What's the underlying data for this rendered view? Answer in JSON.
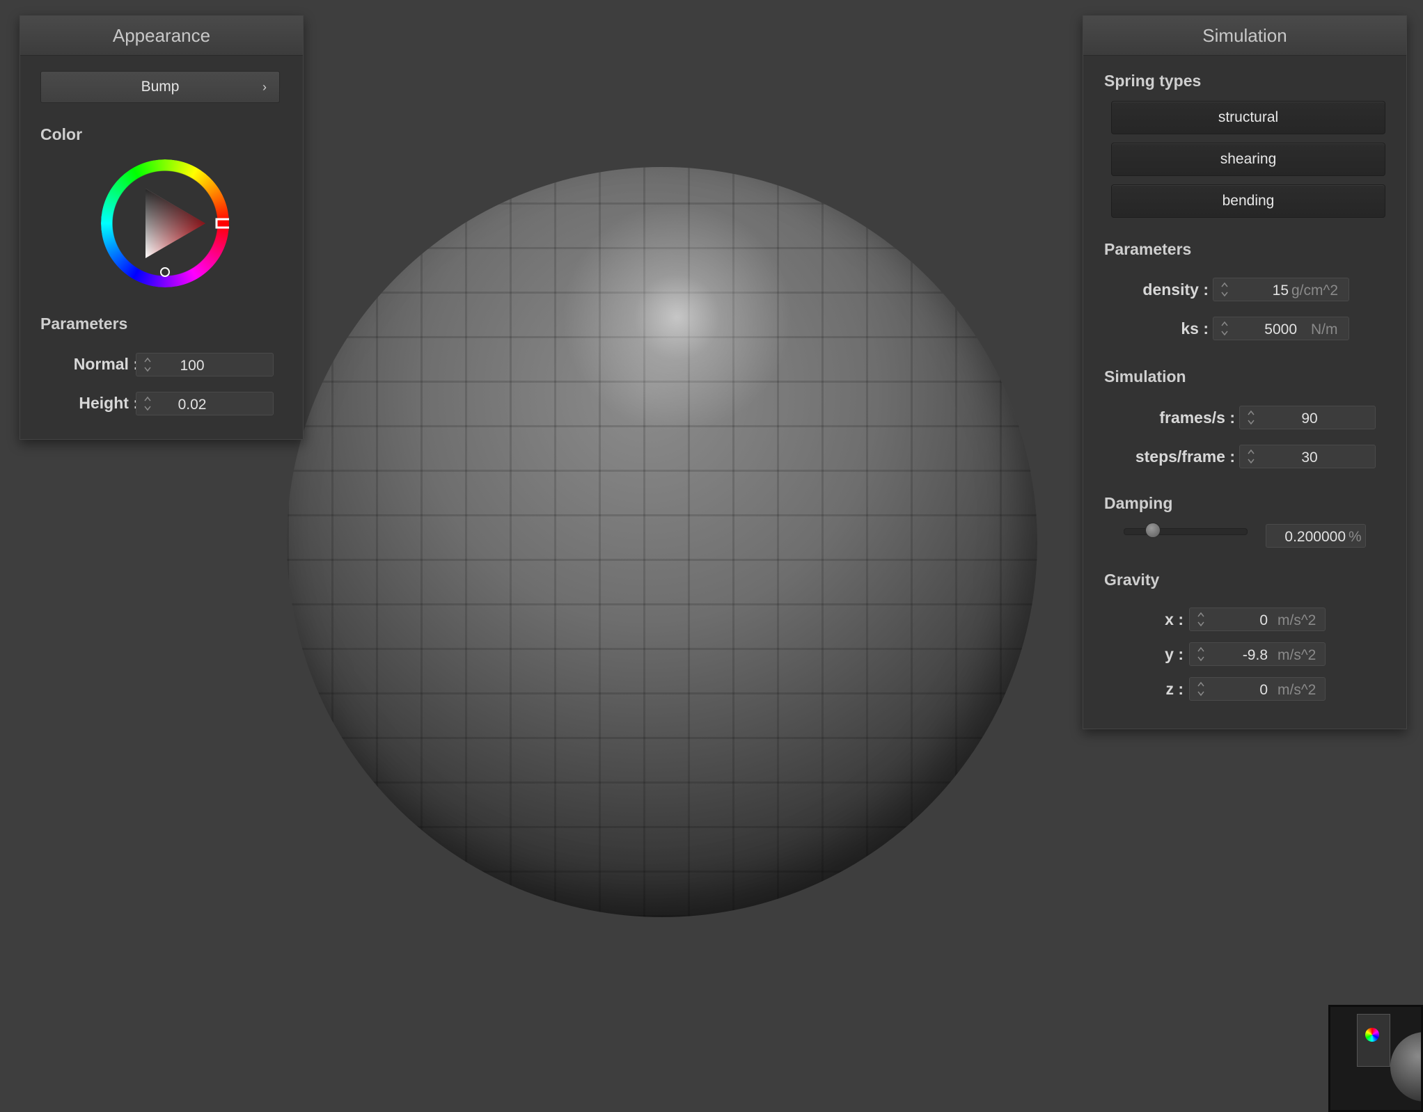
{
  "appearance": {
    "title": "Appearance",
    "material_select": "Bump",
    "color_label": "Color",
    "parameters_label": "Parameters",
    "normal_label": "Normal :",
    "normal_value": "100",
    "height_label": "Height :",
    "height_value": "0.02",
    "selected_color": "#e8212a"
  },
  "simulation": {
    "title": "Simulation",
    "spring_types_label": "Spring types",
    "springs": [
      "structural",
      "shearing",
      "bending"
    ],
    "parameters_label": "Parameters",
    "density": {
      "label": "density :",
      "value": "15",
      "unit": "g/cm^2"
    },
    "ks": {
      "label": "ks :",
      "value": "5000",
      "unit": "N/m"
    },
    "simulation_label": "Simulation",
    "fps": {
      "label": "frames/s :",
      "value": "90"
    },
    "steps": {
      "label": "steps/frame :",
      "value": "30"
    },
    "damping_label": "Damping",
    "damping": {
      "value": "0.200000",
      "unit": "%",
      "level": 0.2
    },
    "gravity_label": "Gravity",
    "gx": {
      "label": "x :",
      "value": "0",
      "unit": "m/s^2"
    },
    "gy": {
      "label": "y :",
      "value": "-9.8",
      "unit": "m/s^2"
    },
    "gz": {
      "label": "z :",
      "value": "0",
      "unit": "m/s^2"
    }
  }
}
